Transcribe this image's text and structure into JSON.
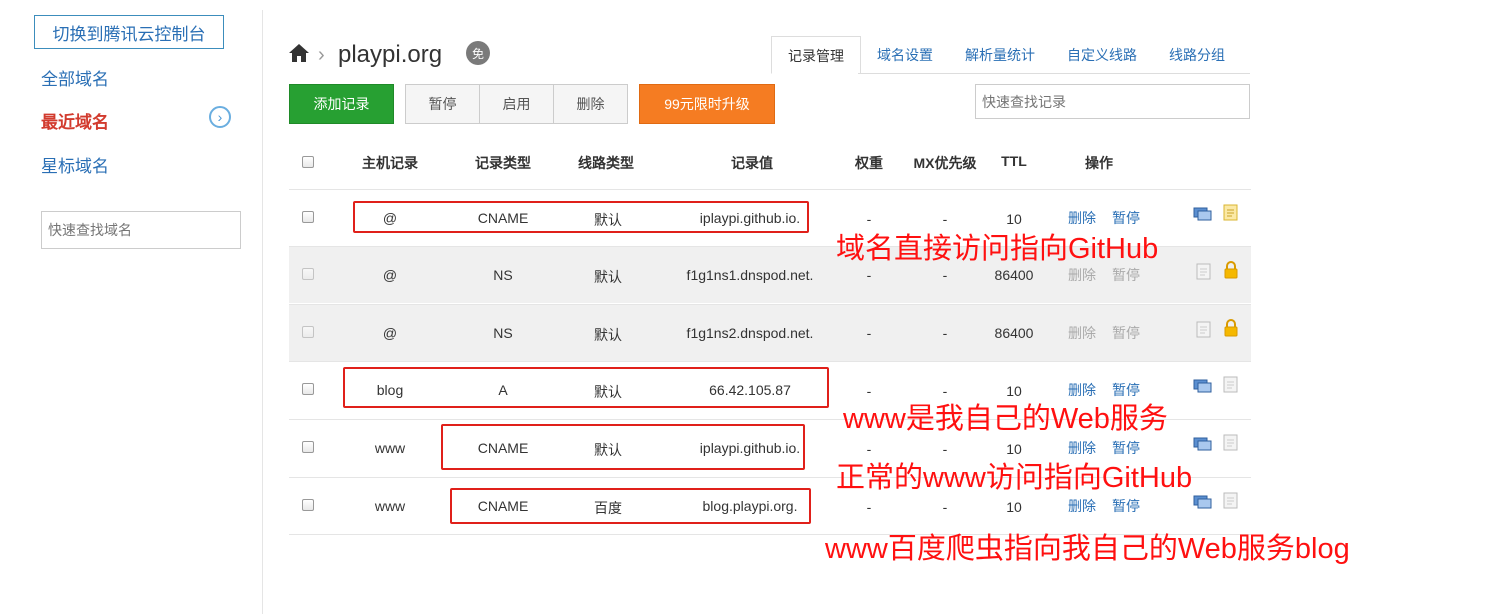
{
  "sidebar": {
    "switch_button": "切换到腾讯云控制台",
    "all_domains": "全部域名",
    "recent_domains": "最近域名",
    "starred_domains": "星标域名",
    "search_placeholder": "快速查找域名"
  },
  "header": {
    "domain": "playpi.org",
    "badge": "免",
    "tabs": [
      "记录管理",
      "域名设置",
      "解析量统计",
      "自定义线路",
      "线路分组"
    ],
    "active_tab": "记录管理"
  },
  "toolbar": {
    "add": "添加记录",
    "pause": "暂停",
    "enable": "启用",
    "delete": "删除",
    "upgrade": "99元限时升级",
    "search_placeholder": "快速查找记录"
  },
  "table": {
    "columns": [
      "主机记录",
      "记录类型",
      "线路类型",
      "记录值",
      "权重",
      "MX优先级",
      "TTL",
      "操作"
    ],
    "rows": [
      {
        "host": "@",
        "type": "CNAME",
        "line": "默认",
        "value": "iplaypi.github.io.",
        "weight": "-",
        "mx": "-",
        "ttl": "10",
        "del": "删除",
        "pause": "暂停",
        "locked": false
      },
      {
        "host": "@",
        "type": "NS",
        "line": "默认",
        "value": "f1g1ns1.dnspod.net.",
        "weight": "-",
        "mx": "-",
        "ttl": "86400",
        "del": "删除",
        "pause": "暂停",
        "locked": true
      },
      {
        "host": "@",
        "type": "NS",
        "line": "默认",
        "value": "f1g1ns2.dnspod.net.",
        "weight": "-",
        "mx": "-",
        "ttl": "86400",
        "del": "删除",
        "pause": "暂停",
        "locked": true
      },
      {
        "host": "blog",
        "type": "A",
        "line": "默认",
        "value": "66.42.105.87",
        "weight": "-",
        "mx": "-",
        "ttl": "10",
        "del": "删除",
        "pause": "暂停",
        "locked": false
      },
      {
        "host": "www",
        "type": "CNAME",
        "line": "默认",
        "value": "iplaypi.github.io.",
        "weight": "-",
        "mx": "-",
        "ttl": "10",
        "del": "删除",
        "pause": "暂停",
        "locked": false
      },
      {
        "host": "www",
        "type": "CNAME",
        "line": "百度",
        "value": "blog.playpi.org.",
        "weight": "-",
        "mx": "-",
        "ttl": "10",
        "del": "删除",
        "pause": "暂停",
        "locked": false
      }
    ]
  },
  "annotations": [
    "域名直接访问指向GitHub",
    "www是我自己的Web服务",
    "正常的www访问指向GitHub",
    "www百度爬虫指向我自己的Web服务blog"
  ],
  "colors": {
    "accent": "#2a6fb5",
    "active": "#d23b2e",
    "add_button": "#27a032",
    "upgrade_button": "#f57c22",
    "annotation": "#ff1010"
  },
  "icons": [
    "home-icon",
    "chevron-right-icon",
    "remark-icon",
    "note-icon",
    "lock-icon"
  ]
}
